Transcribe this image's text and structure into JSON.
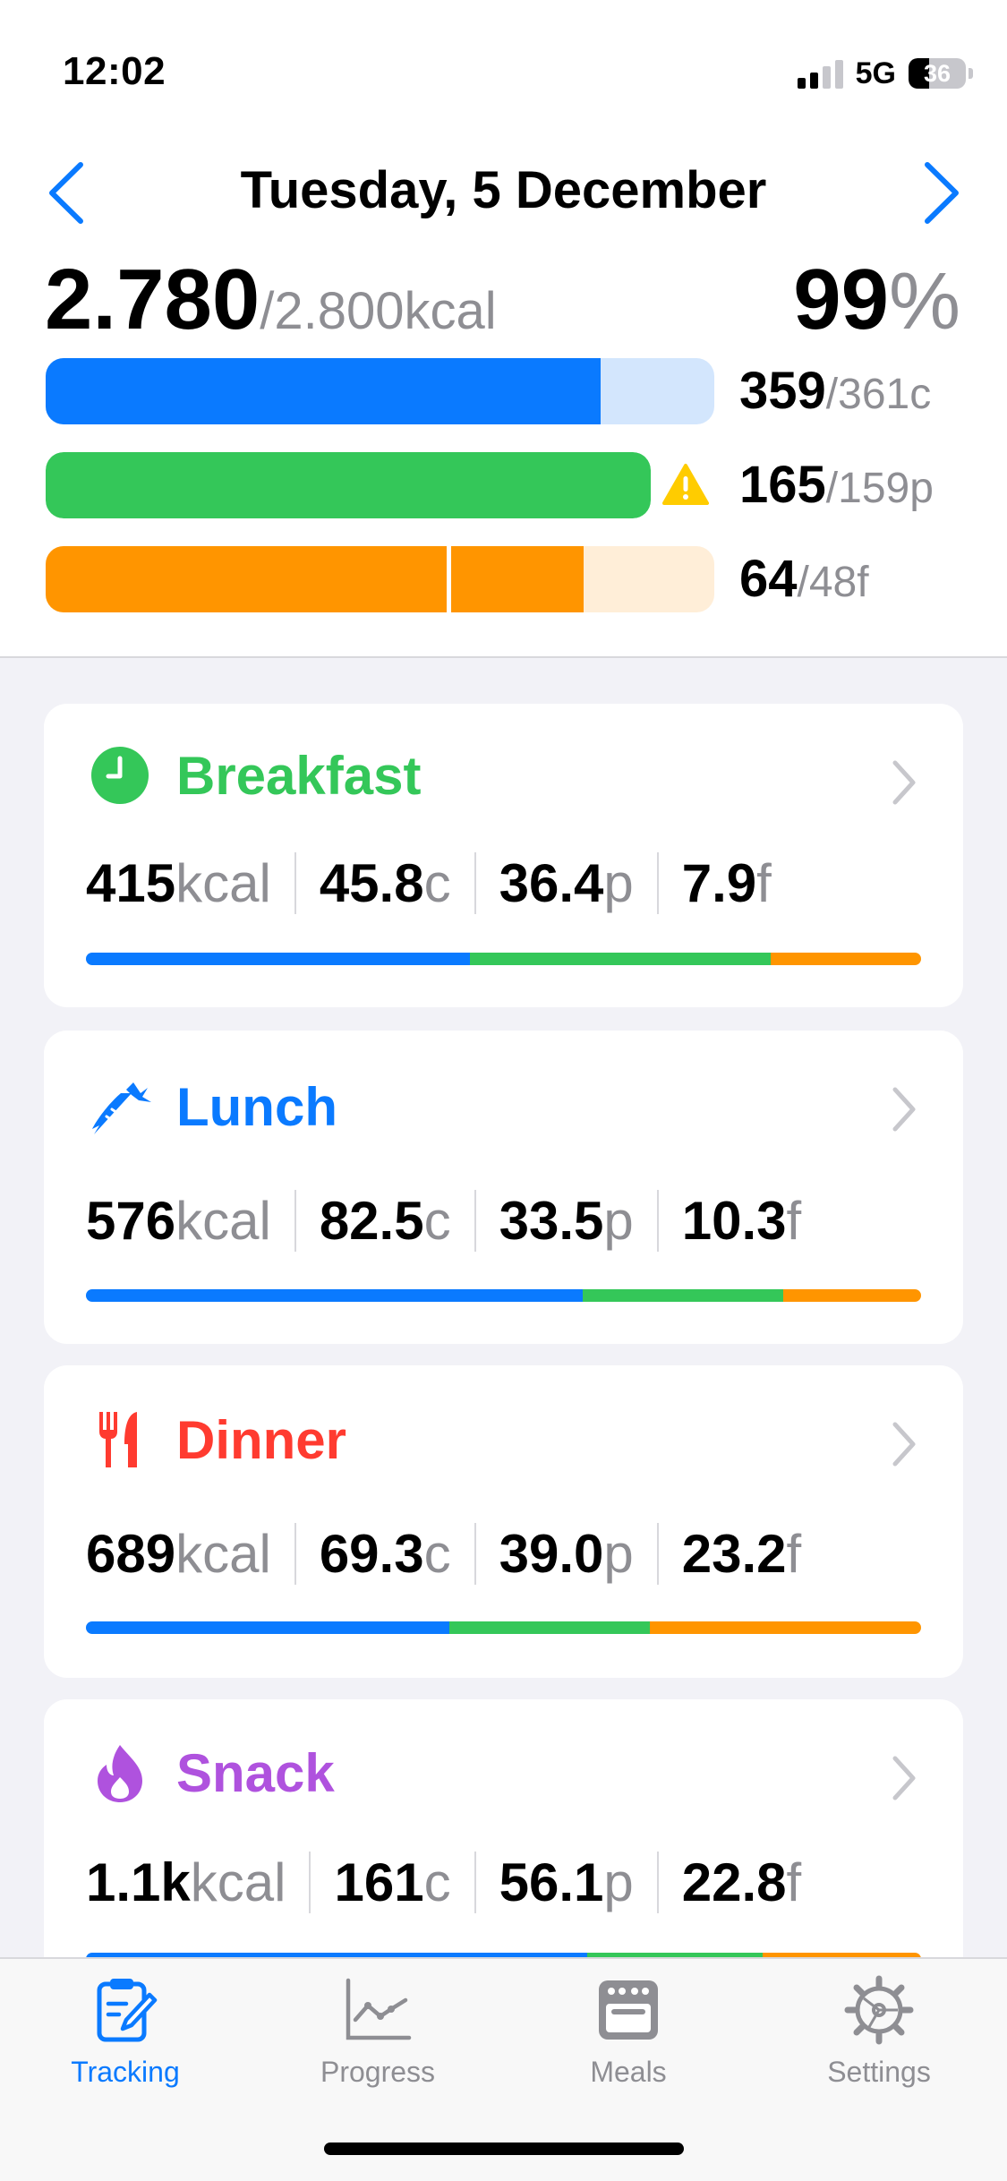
{
  "status_bar": {
    "time": "12:02",
    "network": "5G",
    "battery": "36",
    "battery_level": 0.36
  },
  "header": {
    "date": "Tuesday, 5 December",
    "kcal_consumed": "2.780",
    "kcal_goal": "/2.800kcal",
    "percent": "99",
    "percent_symbol": "%"
  },
  "macros": [
    {
      "name": "carbs",
      "value": "359",
      "goal": "/361c",
      "fraction": 0.83,
      "color": "#0a7aff",
      "track": "#d3e6fd",
      "warning": false
    },
    {
      "name": "protein",
      "value": "165",
      "goal": "/159p",
      "fraction": 1.0,
      "color": "#34c759",
      "track": "#d6f4dd",
      "warning": true
    },
    {
      "name": "fat",
      "value": "64",
      "goal": "/48f",
      "fraction": 0.805,
      "overflow_marker": 0.6,
      "color": "#ff9500",
      "track": "#ffeed8",
      "warning": false
    }
  ],
  "colors": {
    "carbs": "#0a7aff",
    "protein": "#34c759",
    "fat": "#ff9500",
    "breakfast": "#34c759",
    "lunch": "#0a7aff",
    "dinner": "#ff3b30",
    "snack": "#af52de"
  },
  "meals": [
    {
      "name": "Breakfast",
      "icon": "clock-icon",
      "kcal": "415",
      "kcal_unit": "kcal",
      "carbs": "45.8",
      "carbs_unit": "c",
      "protein": "36.4",
      "protein_unit": "p",
      "fat": "7.9",
      "fat_unit": "f",
      "split": [
        0.46,
        0.36,
        0.18
      ]
    },
    {
      "name": "Lunch",
      "icon": "carrot-icon",
      "kcal": "576",
      "kcal_unit": "kcal",
      "carbs": "82.5",
      "carbs_unit": "c",
      "protein": "33.5",
      "protein_unit": "p",
      "fat": "10.3",
      "fat_unit": "f",
      "split": [
        0.595,
        0.24,
        0.165
      ]
    },
    {
      "name": "Dinner",
      "icon": "fork-knife-icon",
      "kcal": "689",
      "kcal_unit": "kcal",
      "carbs": "69.3",
      "carbs_unit": "c",
      "protein": "39.0",
      "protein_unit": "p",
      "fat": "23.2",
      "fat_unit": "f",
      "split": [
        0.435,
        0.24,
        0.325
      ]
    },
    {
      "name": "Snack",
      "icon": "flame-icon",
      "kcal": "1.1k",
      "kcal_unit": "kcal",
      "carbs": "161",
      "carbs_unit": "c",
      "protein": "56.1",
      "protein_unit": "p",
      "fat": "22.8",
      "fat_unit": "f",
      "split": [
        0.6,
        0.21,
        0.19
      ]
    }
  ],
  "tabs": [
    {
      "label": "Tracking",
      "icon": "clipboard-pencil-icon",
      "active": true
    },
    {
      "label": "Progress",
      "icon": "line-chart-icon",
      "active": false
    },
    {
      "label": "Meals",
      "icon": "oven-icon",
      "active": false
    },
    {
      "label": "Settings",
      "icon": "gear-icon",
      "active": false
    }
  ]
}
